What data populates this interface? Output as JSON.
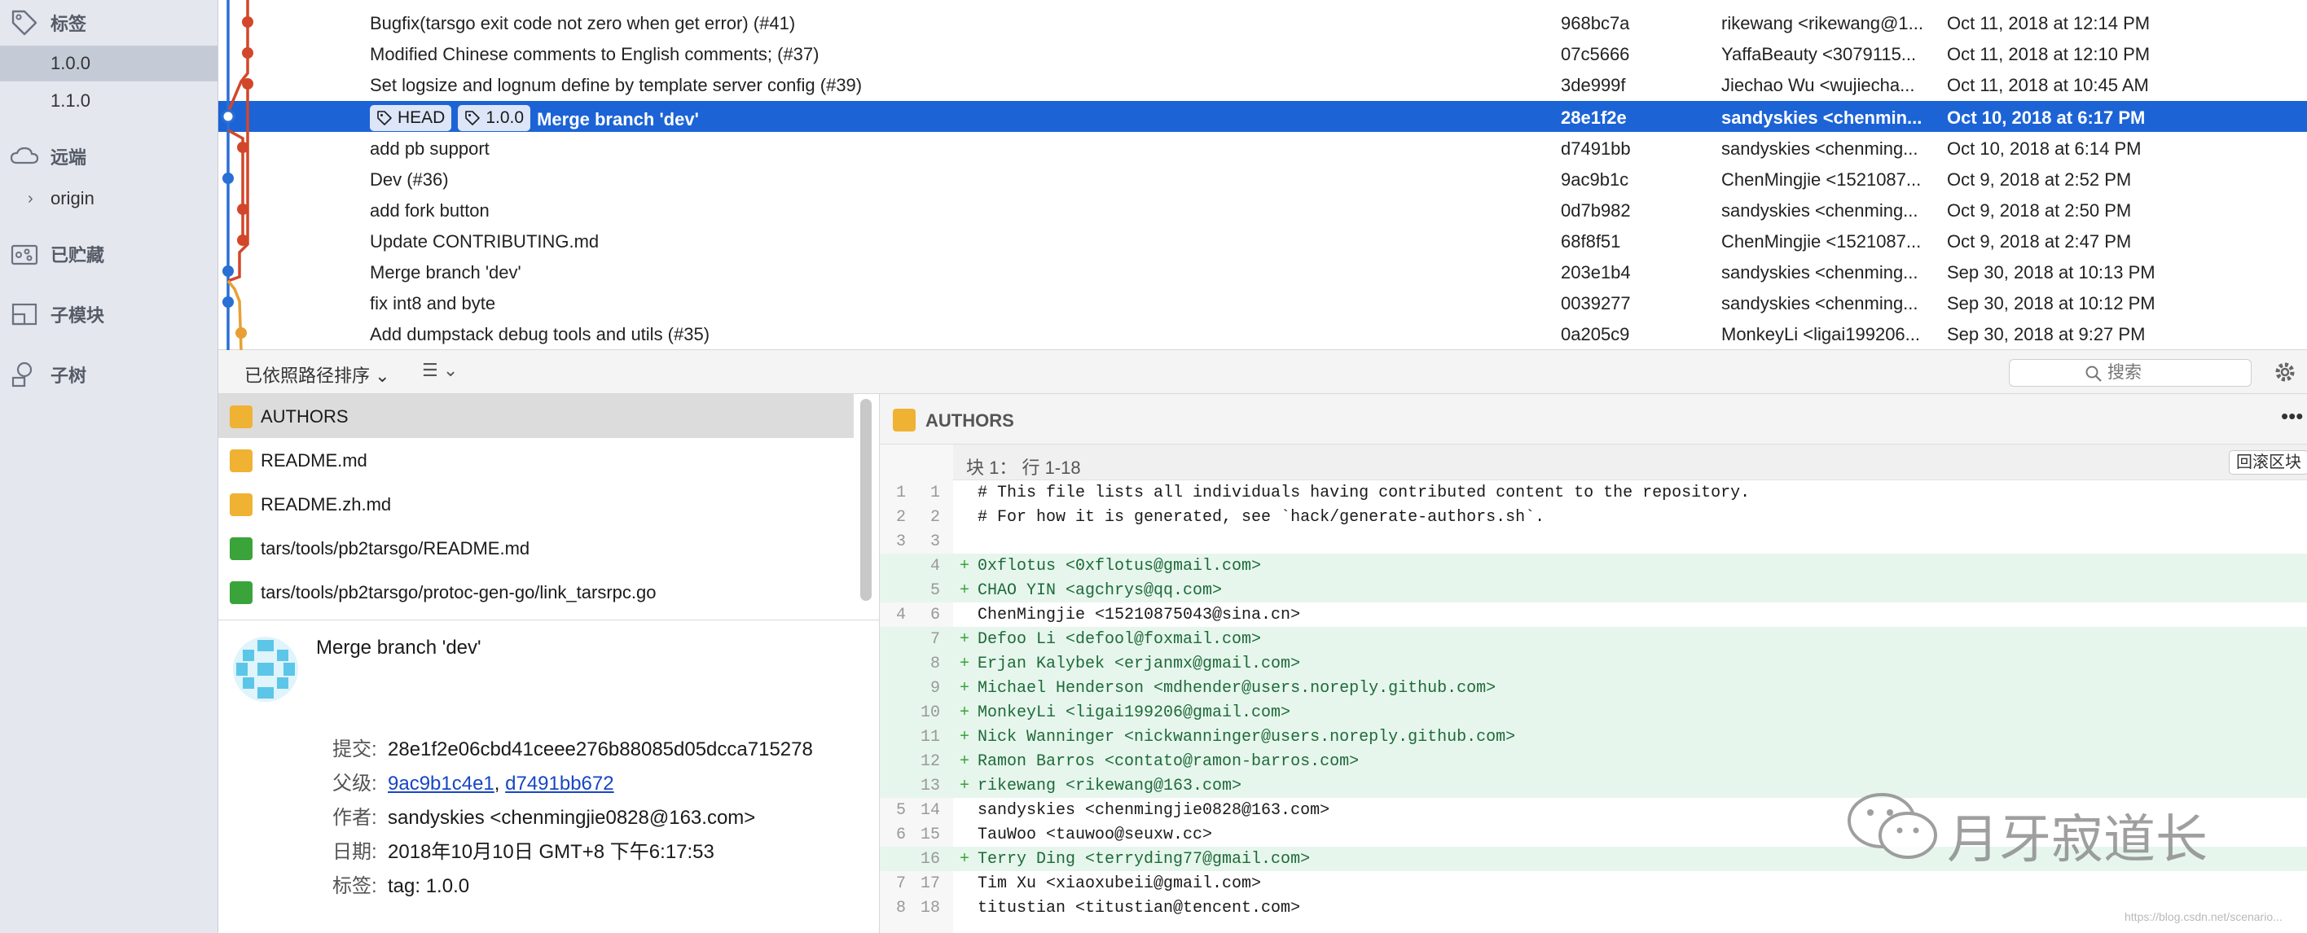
{
  "sidebar": {
    "tags_label": "标签",
    "tags": [
      "1.0.0",
      "1.1.0"
    ],
    "remotes_label": "远端",
    "remotes": [
      "origin"
    ],
    "stashes_label": "已贮藏",
    "submodules_label": "子模块",
    "subtrees_label": "子树"
  },
  "commits": [
    {
      "message": "Bugfix(tarsgo exit code not zero when get error) (#41)",
      "hash": "968bc7a",
      "author": "rikewang <rikewang@1...",
      "date": "Oct 11, 2018 at 12:14 PM"
    },
    {
      "message": "Modified Chinese comments to English comments; (#37)",
      "hash": "07c5666",
      "author": "YaffaBeauty <3079115...",
      "date": "Oct 11, 2018 at 12:10 PM"
    },
    {
      "message": "Set logsize and lognum define by template server config (#39)",
      "hash": "3de999f",
      "author": "Jiechao Wu <wujiecha...",
      "date": "Oct 11, 2018 at 10:45 AM"
    },
    {
      "message": "Merge branch 'dev'",
      "hash": "28e1f2e",
      "author": "sandyskies <chenmin...",
      "date": "Oct 10, 2018 at 6:17 PM",
      "tags": [
        "HEAD",
        "1.0.0"
      ]
    },
    {
      "message": "add pb support",
      "hash": "d7491bb",
      "author": "sandyskies <chenming...",
      "date": "Oct 10, 2018 at 6:14 PM"
    },
    {
      "message": "Dev (#36)",
      "hash": "9ac9b1c",
      "author": "ChenMingjie <1521087...",
      "date": "Oct 9, 2018 at 2:52 PM"
    },
    {
      "message": "add fork button",
      "hash": "0d7b982",
      "author": "sandyskies <chenming...",
      "date": "Oct 9, 2018 at 2:50 PM"
    },
    {
      "message": "Update CONTRIBUTING.md",
      "hash": "68f8f51",
      "author": "ChenMingjie <1521087...",
      "date": "Oct 9, 2018 at 2:47 PM"
    },
    {
      "message": "Merge branch 'dev'",
      "hash": "203e1b4",
      "author": "sandyskies <chenming...",
      "date": "Sep 30, 2018 at 10:13 PM"
    },
    {
      "message": "fix int8 and byte",
      "hash": "0039277",
      "author": "sandyskies <chenming...",
      "date": "Sep 30, 2018 at 10:12 PM"
    },
    {
      "message": "Add dumpstack debug tools and utils (#35)",
      "hash": "0a205c9",
      "author": "MonkeyLi <ligai199206...",
      "date": "Sep 30, 2018 at 9:27 PM"
    }
  ],
  "toolbar": {
    "sort_label": "已依照路径排序",
    "search_placeholder": "搜索"
  },
  "files": [
    {
      "name": "AUTHORS",
      "status": "modified"
    },
    {
      "name": "README.md",
      "status": "modified"
    },
    {
      "name": "README.zh.md",
      "status": "modified"
    },
    {
      "name": "tars/tools/pb2tarsgo/README.md",
      "status": "added"
    },
    {
      "name": "tars/tools/pb2tarsgo/protoc-gen-go/link_tarsrpc.go",
      "status": "added"
    }
  ],
  "details": {
    "title": "Merge branch 'dev'",
    "commit_label": "提交:",
    "commit": "28e1f2e06cbd41ceee276b88085d05dcca715278",
    "parents_label": "父级:",
    "parent1": "9ac9b1c4e1",
    "parent2": "d7491bb672",
    "author_label": "作者:",
    "author": "sandyskies <chenmingjie0828@163.com>",
    "date_label": "日期:",
    "date": "2018年10月10日 GMT+8 下午6:17:53",
    "tags_label": "标签:",
    "tags": "tag: 1.0.0"
  },
  "diff": {
    "file": "AUTHORS",
    "hunk": "块 1：  行 1-18",
    "revert_label": "回滚区块",
    "lines": [
      {
        "old": "1",
        "new": "1",
        "type": "ctx",
        "text": "# This file lists all individuals having contributed content to the repository."
      },
      {
        "old": "2",
        "new": "2",
        "type": "ctx",
        "text": "# For how it is generated, see `hack/generate-authors.sh`."
      },
      {
        "old": "3",
        "new": "3",
        "type": "ctx",
        "text": ""
      },
      {
        "old": "",
        "new": "4",
        "type": "add",
        "text": "0xflotus <0xflotus@gmail.com>"
      },
      {
        "old": "",
        "new": "5",
        "type": "add",
        "text": "CHAO YIN <agchrys@qq.com>"
      },
      {
        "old": "4",
        "new": "6",
        "type": "ctx",
        "text": "ChenMingjie <15210875043@sina.cn>"
      },
      {
        "old": "",
        "new": "7",
        "type": "add",
        "text": "Defoo Li <defool@foxmail.com>"
      },
      {
        "old": "",
        "new": "8",
        "type": "add",
        "text": "Erjan Kalybek <erjanmx@gmail.com>"
      },
      {
        "old": "",
        "new": "9",
        "type": "add",
        "text": "Michael Henderson <mdhender@users.noreply.github.com>"
      },
      {
        "old": "",
        "new": "10",
        "type": "add",
        "text": "MonkeyLi <ligai199206@gmail.com>"
      },
      {
        "old": "",
        "new": "11",
        "type": "add",
        "text": "Nick Wanninger <nickwanninger@users.noreply.github.com>"
      },
      {
        "old": "",
        "new": "12",
        "type": "add",
        "text": "Ramon Barros <contato@ramon-barros.com>"
      },
      {
        "old": "",
        "new": "13",
        "type": "add",
        "text": "rikewang <rikewang@163.com>"
      },
      {
        "old": "5",
        "new": "14",
        "type": "ctx",
        "text": "sandyskies <chenmingjie0828@163.com>"
      },
      {
        "old": "6",
        "new": "15",
        "type": "ctx",
        "text": "TauWoo <tauwoo@seuxw.cc>"
      },
      {
        "old": "",
        "new": "16",
        "type": "add",
        "text": "Terry Ding <terryding77@gmail.com>"
      },
      {
        "old": "7",
        "new": "17",
        "type": "ctx",
        "text": "Tim Xu <xiaoxubeii@gmail.com>"
      },
      {
        "old": "8",
        "new": "18",
        "type": "ctx",
        "text": "titustian <titustian@tencent.com>"
      }
    ]
  },
  "watermark": {
    "text": "月牙寂道长",
    "url": "https://blog.csdn.net/scenario..."
  },
  "colors": {
    "selection": "#1c63d6",
    "graph_red": "#d2472a",
    "graph_blue": "#2a6fd6",
    "graph_orange": "#e8a034",
    "added_bg": "#e6f6ec",
    "modified_badge": "#efb233",
    "added_badge": "#3aa33a"
  }
}
